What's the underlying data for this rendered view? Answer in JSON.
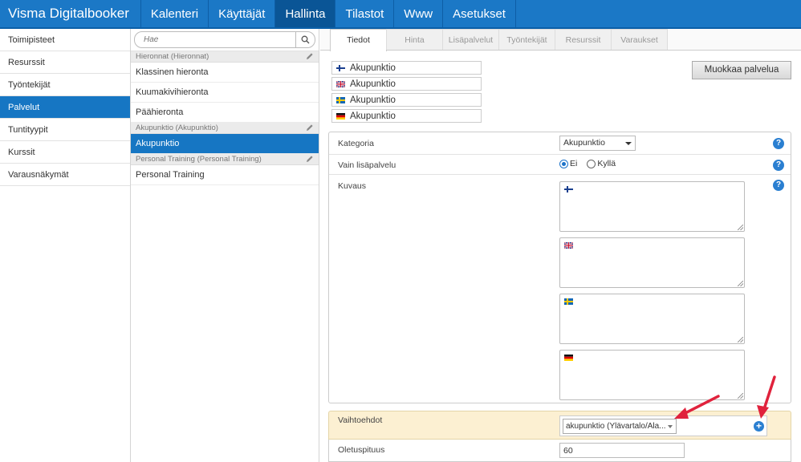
{
  "topnav": {
    "brand": "Visma Digitalbooker",
    "items": [
      "Kalenteri",
      "Käyttäjät",
      "Hallinta",
      "Tilastot",
      "Www",
      "Asetukset"
    ],
    "active": "Hallinta"
  },
  "sidebar": {
    "items": [
      "Toimipisteet",
      "Resurssit",
      "Työntekijät",
      "Palvelut",
      "Tuntityypit",
      "Kurssit",
      "Varausnäkymät"
    ],
    "active": "Palvelut"
  },
  "services": {
    "search_placeholder": "Hae",
    "groups": [
      {
        "header": "Hieronnat (Hieronnat)",
        "items": [
          "Klassinen hieronta",
          "Kuumakivihieronta",
          "Päähieronta"
        ]
      },
      {
        "header": "Akupunktio (Akupunktio)",
        "items": [
          "Akupunktio"
        ]
      },
      {
        "header": "Personal Training (Personal Training)",
        "items": [
          "Personal Training"
        ]
      }
    ],
    "active": "Akupunktio"
  },
  "tabs": [
    "Tiedot",
    "Hinta",
    "Lisäpalvelut",
    "Työntekijät",
    "Resurssit",
    "Varaukset"
  ],
  "active_tab": "Tiedot",
  "names": [
    {
      "lang": "fi",
      "value": "Akupunktio"
    },
    {
      "lang": "en",
      "value": "Akupunktio"
    },
    {
      "lang": "sv",
      "value": "Akupunktio"
    },
    {
      "lang": "de",
      "value": "Akupunktio"
    }
  ],
  "edit_button": "Muokkaa palvelua",
  "form": {
    "kategoria_label": "Kategoria",
    "kategoria_value": "Akupunktio",
    "vain_label": "Vain lisäpalvelu",
    "option_no": "Ei",
    "option_yes": "Kyllä",
    "kuvaus_label": "Kuvaus",
    "vaihtoehdot_label": "Vaihtoehdot",
    "vaihtoehdot_value": "akupunktio (Ylävartalo/Ala...",
    "oletuspituus_label": "Oletuspituus",
    "oletuspituus_value": "60"
  },
  "icons": {
    "help": "?",
    "plus": "+"
  },
  "colors": {
    "nav": "#1b78c6",
    "active": "#1676c3",
    "arrow": "#e0223c",
    "highlight": "#fcf0d2"
  }
}
